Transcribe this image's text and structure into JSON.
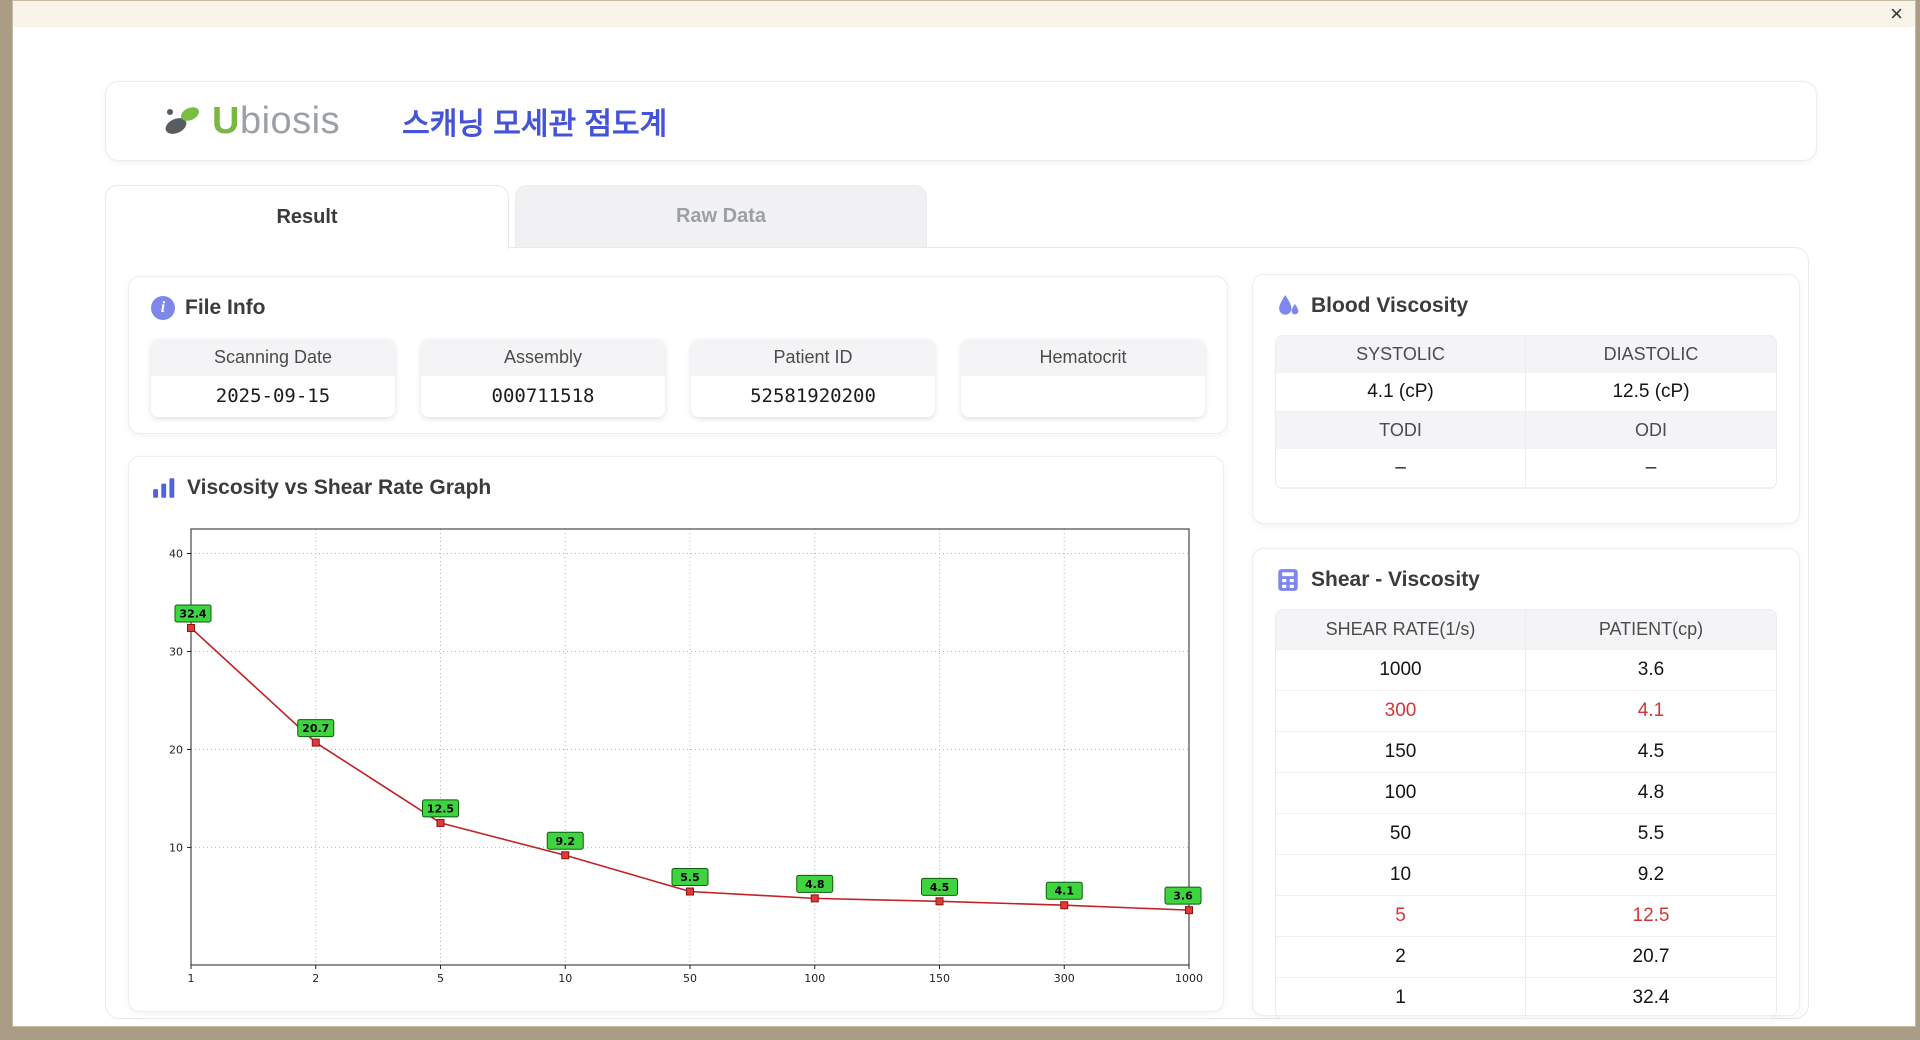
{
  "window": {
    "close_label": "×"
  },
  "header": {
    "brand_prefix": "U",
    "brand_suffix": "biosis",
    "app_title": "스캐닝 모세관 점도계"
  },
  "tabs": {
    "result": "Result",
    "raw_data": "Raw Data"
  },
  "file_info": {
    "title": "File Info",
    "fields": [
      {
        "label": "Scanning Date",
        "value": "2025-09-15"
      },
      {
        "label": "Assembly",
        "value": "000711518"
      },
      {
        "label": "Patient ID",
        "value": "52581920200"
      },
      {
        "label": "Hematocrit",
        "value": ""
      }
    ]
  },
  "blood_viscosity": {
    "title": "Blood Viscosity",
    "groups": [
      {
        "cells": [
          {
            "label": "SYSTOLIC",
            "value": "4.1 (cP)"
          },
          {
            "label": "DIASTOLIC",
            "value": "12.5 (cP)"
          }
        ]
      },
      {
        "cells": [
          {
            "label": "TODI",
            "value": "–"
          },
          {
            "label": "ODI",
            "value": "–"
          }
        ]
      }
    ]
  },
  "graph": {
    "title": "Viscosity vs Shear Rate Graph"
  },
  "shear_viscosity": {
    "title": "Shear - Viscosity",
    "columns": [
      "SHEAR RATE(1/s)",
      "PATIENT(cp)"
    ],
    "rows": [
      {
        "shear_rate": "1000",
        "patient": "3.6",
        "highlight": false
      },
      {
        "shear_rate": "300",
        "patient": "4.1",
        "highlight": true
      },
      {
        "shear_rate": "150",
        "patient": "4.5",
        "highlight": false
      },
      {
        "shear_rate": "100",
        "patient": "4.8",
        "highlight": false
      },
      {
        "shear_rate": "50",
        "patient": "5.5",
        "highlight": false
      },
      {
        "shear_rate": "10",
        "patient": "9.2",
        "highlight": false
      },
      {
        "shear_rate": "5",
        "patient": "12.5",
        "highlight": true
      },
      {
        "shear_rate": "2",
        "patient": "20.7",
        "highlight": false
      },
      {
        "shear_rate": "1",
        "patient": "32.4",
        "highlight": false
      }
    ]
  },
  "chart_data": {
    "type": "line",
    "title": "Viscosity vs Shear Rate Graph",
    "x": [
      1,
      2,
      5,
      10,
      50,
      100,
      150,
      300,
      1000
    ],
    "values": [
      32.4,
      20.7,
      12.5,
      9.2,
      5.5,
      4.8,
      4.5,
      4.1,
      3.6
    ],
    "x_scale": "category",
    "x_ticks": [
      1,
      2,
      5,
      10,
      50,
      100,
      150,
      300,
      1000
    ],
    "y_ticks": [
      10,
      20,
      30,
      40
    ],
    "ylim": [
      -2,
      42.5
    ],
    "grid": "dotted",
    "legend": "none",
    "xlabel": "",
    "ylabel": "",
    "line_color": "#c22126",
    "marker_color": "#e23b36",
    "marker_edge": "#8a1313",
    "label_bg": "#3fd43f",
    "label_edge": "#0b5e0b"
  },
  "colors": {
    "accent_blue": "#4553d6",
    "icon_blue": "#7d88ea",
    "highlight_red": "#d23737",
    "brand_green": "#79b843",
    "brand_gray": "#9aa0a6",
    "desktop_tan": "#ab9d85",
    "titlebar_cream": "#f8f4e9"
  }
}
